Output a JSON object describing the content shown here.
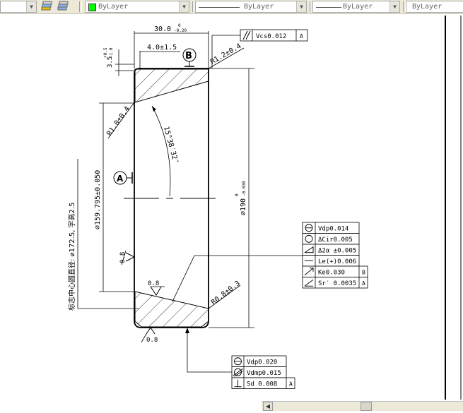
{
  "toolbar": {
    "color_dropdown": "ByLayer",
    "linetype_dropdown": "ByLayer",
    "lineweight_dropdown": "ByLayer",
    "plotstyle_dropdown": "ByLayer",
    "color_swatch": "#00ff00"
  },
  "drawing": {
    "dim_width": "30.0",
    "dim_width_tol_upper": "0",
    "dim_width_tol_lower": "-0.20",
    "dim_offset": "4.0±1.5",
    "dim_small": "3.5",
    "dim_small_tol_upper": "+0.5",
    "dim_small_tol_lower": "-1.0",
    "datum_b": "B",
    "datum_a": "A",
    "radius_top_right": "R1.2±0.4",
    "radius_left": "R1.0±0.4",
    "radius_bottom_right": "R0.8±0.3",
    "angle": "15°38′32″",
    "dim_diameter": "⌀159.795±0.050",
    "dim_ref": "标志中心圆直径: ⌀172.5, 字高2.5",
    "dim_height": "⌀190",
    "dim_height_tol_upper": "0",
    "dim_height_tol_lower": "-0.030",
    "rough_left": "0.8",
    "rough_bottom": "0.8",
    "rough_top": "0.8",
    "fcf_top": [
      {
        "symbol": "parallel-icon",
        "value": "Vcs0.012",
        "datum": "A"
      }
    ],
    "fcf_right": [
      {
        "symbol": "circle-minus-icon",
        "value": "Vdp0.014",
        "datum": ""
      },
      {
        "symbol": "circle-icon",
        "value": "ΔCir0.005",
        "datum": ""
      },
      {
        "symbol": "taper-icon",
        "value": "Δ2α ±0.005",
        "datum": ""
      },
      {
        "symbol": "line-icon",
        "value": "Le(+)0.006",
        "datum": ""
      },
      {
        "symbol": "arrow-icon",
        "value": "Ke0.030",
        "datum": "B"
      },
      {
        "symbol": "slope-icon",
        "value": "Sr′ 0.0035",
        "datum": "A"
      }
    ],
    "fcf_bottom": [
      {
        "symbol": "circle-minus-icon",
        "value": "Vdp0.020",
        "datum": ""
      },
      {
        "symbol": "circle-slash-icon",
        "value": "Vdmp0.015",
        "datum": ""
      },
      {
        "symbol": "perp-icon",
        "value": "Sd 0.008",
        "datum": "A"
      }
    ]
  }
}
